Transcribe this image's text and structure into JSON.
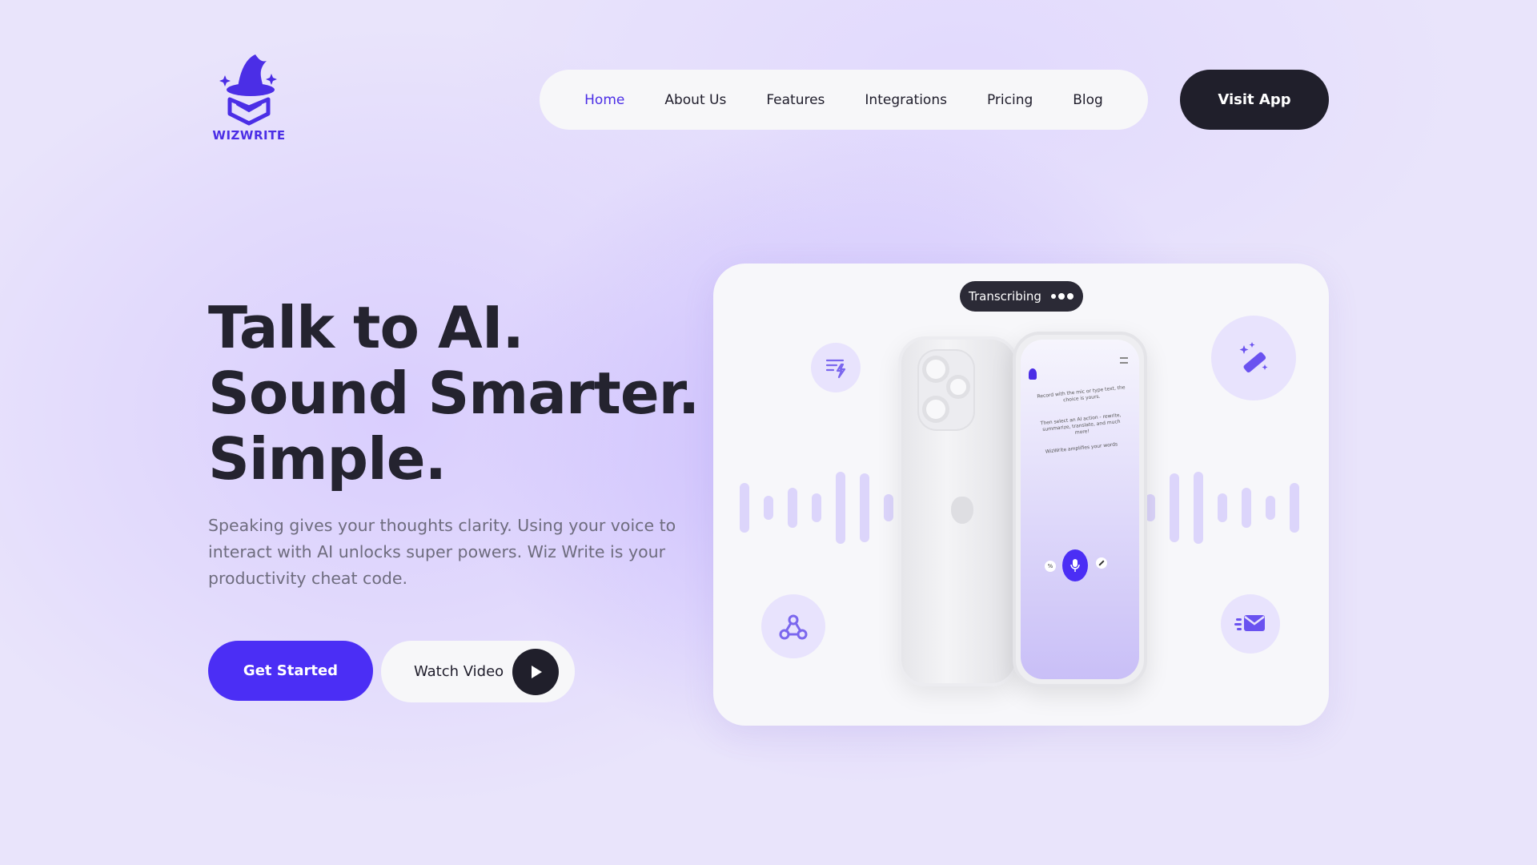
{
  "brand": {
    "name": "WIZWRITE",
    "logo_icon": "wizard-hat-book-icon",
    "color": "#4b2ee6"
  },
  "nav": {
    "items": [
      {
        "label": "Home",
        "active": true
      },
      {
        "label": "About Us",
        "active": false
      },
      {
        "label": "Features",
        "active": false
      },
      {
        "label": "Integrations",
        "active": false
      },
      {
        "label": "Pricing",
        "active": false
      },
      {
        "label": "Blog",
        "active": false
      }
    ],
    "cta_label": "Visit App"
  },
  "hero": {
    "title_lines": [
      "Talk to AI.",
      "Sound Smarter.",
      "Simple."
    ],
    "subtitle": "Speaking gives your thoughts clarity. Using your voice to interact with AI unlocks super powers. Wiz Write is your productivity cheat code.",
    "primary_button": "Get Started",
    "secondary_button": "Watch Video",
    "secondary_icon": "play-icon"
  },
  "showcase": {
    "status_pill": "Transcribing",
    "icons": [
      "sort-lightning-icon",
      "magic-wand-icon",
      "webhook-icon",
      "fast-mail-icon"
    ],
    "phone_screen": {
      "text_1": "Record with the mic or type text, the choice is yours.",
      "text_2": "Then select an AI action - rewrite, summarize, translate, and much more!",
      "text_3": "WizWrite amplifies your words"
    }
  },
  "colors": {
    "accent": "#4b2ef5",
    "dark": "#201f2b",
    "text": "#24232f",
    "muted": "#6e6c7e"
  }
}
